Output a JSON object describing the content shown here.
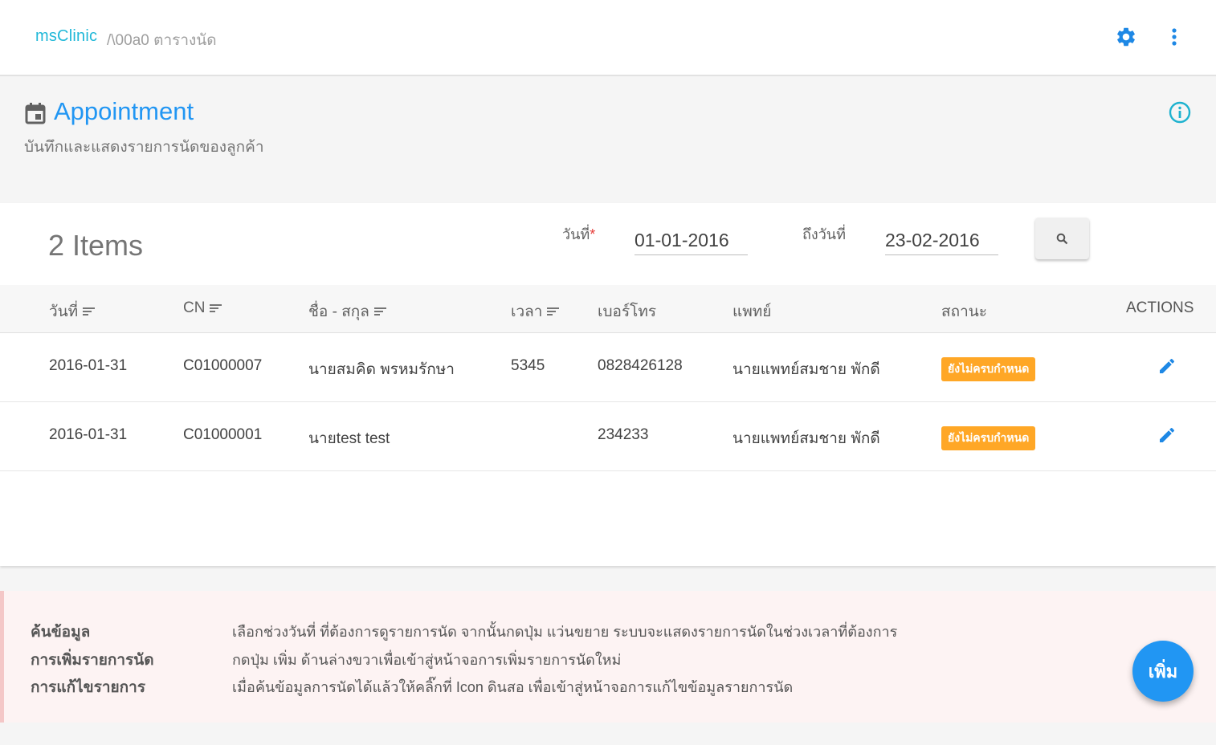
{
  "topbar": {
    "brand": "msClinic",
    "breadcrumb": "/\\00a0 ตารางนัด",
    "accent_color": "#20b8d8",
    "icons": [
      "gear-icon",
      "more-vert-icon"
    ]
  },
  "header": {
    "title": "Appointment",
    "subtitle": "บันทึกและแสดงรายการนัดของลูกค้า",
    "title_color": "#2196f3",
    "icons": [
      "calendar-icon",
      "info-icon"
    ]
  },
  "filter": {
    "count": "2 Items",
    "from_label": "วันที่",
    "required_mark": "*",
    "from_value": "01-01-2016",
    "to_label": "ถึงวันที่",
    "to_value": "23-02-2016",
    "search_icon": "search-icon"
  },
  "table": {
    "columns": [
      "วันที่",
      "CN",
      "ชื่อ - สกุล",
      "เวลา",
      "เบอร์โทร",
      "แพทย์",
      "สถานะ",
      "ACTIONS"
    ],
    "rows": [
      {
        "date": "2016-01-31",
        "cn": "C01000007",
        "name": "นายสมคิด พรหมรักษา",
        "time": "5345",
        "phone": "0828426128",
        "doctor": "นายแพทย์สมชาย พักดี",
        "status": "ยังไม่ครบกำหนด"
      },
      {
        "date": "2016-01-31",
        "cn": "C01000001",
        "name": "นายtest test",
        "time": "",
        "phone": "234233",
        "doctor": "นายแพทย์สมชาย พักดี",
        "status": "ยังไม่ครบกำหนด"
      }
    ],
    "status_color": "#ffa726",
    "edit_icon": "pencil-icon"
  },
  "help": [
    {
      "key": "ค้นข้อมูล",
      "text": "เลือกช่วงวันที่ ที่ต้องการดูรายการนัด จากนั้นกดปุ่ม แว่นขยาย ระบบจะแสดงรายการนัดในช่วงเวลาที่ต้องการ"
    },
    {
      "key": "การเพิ่มรายการนัด",
      "text": "กดปุ่ม เพิ่ม ด้านล่างขวาเพื่อเข้าสู่หน้าจอการเพิ่มรายการนัดใหม่"
    },
    {
      "key": "การแก้ไขรายการ",
      "text": "เมื่อค้นข้อมูลการนัดได้แล้วให้คลิ๊กที่ Icon ดินสอ เพื่อเข้าสู่หน้าจอการแก้ไขข้อมูลรายการนัด"
    }
  ],
  "fab": {
    "label": "เพิ่ม"
  }
}
